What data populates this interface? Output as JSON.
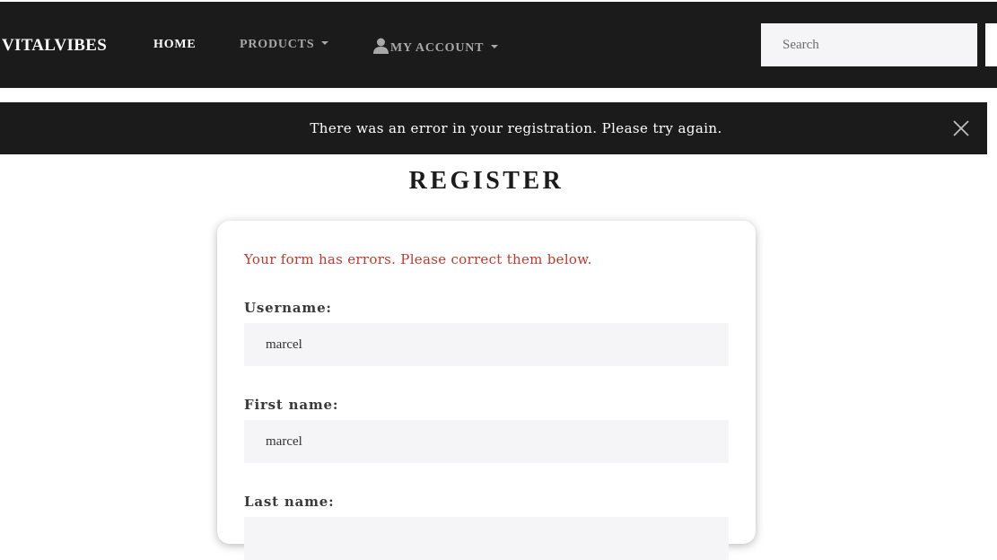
{
  "navbar": {
    "brand": "VITALVIBES",
    "links": [
      {
        "label": "HOME"
      },
      {
        "label": "PRODUCTS"
      },
      {
        "label": "MY ACCOUNT"
      }
    ],
    "search": {
      "placeholder": "Search",
      "value": ""
    }
  },
  "alert": {
    "message": "There was an error in your registration. Please try again.",
    "close_icon": "close-icon"
  },
  "page": {
    "title": "REGISTER"
  },
  "form": {
    "error_message": "Your form has errors. Please correct them below.",
    "fields": [
      {
        "label": "Username:",
        "value": "marcel"
      },
      {
        "label": "First name:",
        "value": "marcel"
      },
      {
        "label": "Last name:",
        "value": ""
      }
    ]
  },
  "colors": {
    "nav_background": "#1b1b1b",
    "error_text": "#c0392b",
    "input_background": "#f5f5f7"
  }
}
